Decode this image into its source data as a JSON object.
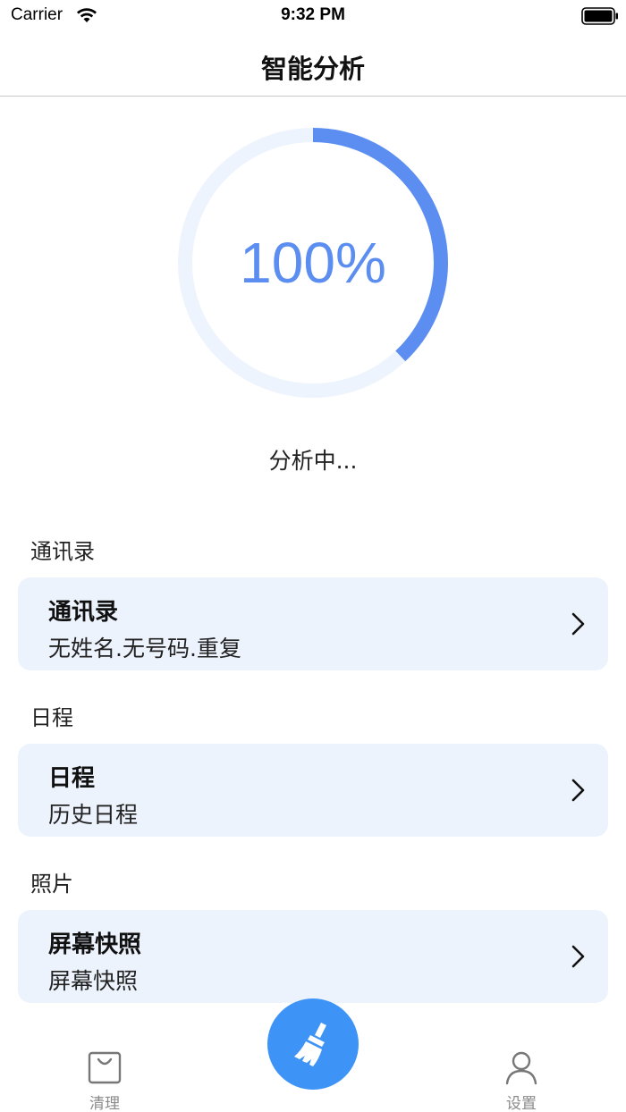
{
  "status_bar": {
    "carrier": "Carrier",
    "time": "9:32 PM",
    "wifi_icon": "wifi-icon",
    "battery_icon": "battery-icon"
  },
  "nav": {
    "title": "智能分析"
  },
  "progress": {
    "label": "100%",
    "fraction_drawn": 0.38,
    "status": "分析中...",
    "colors": {
      "arc": "#5b8ef0",
      "track": "#eef4fd",
      "text": "#5b8ef0"
    }
  },
  "sections": [
    {
      "title": "通讯录",
      "card_title": "通讯录",
      "card_subtitle": "无姓名.无号码.重复",
      "icon": "chevron-right-icon"
    },
    {
      "title": "日程",
      "card_title": "日程",
      "card_subtitle": "历史日程",
      "icon": "chevron-right-icon"
    },
    {
      "title": "照片",
      "card_title": "屏幕快照",
      "card_subtitle": "屏幕快照",
      "icon": "chevron-right-icon"
    }
  ],
  "tab_bar": {
    "left": {
      "label": "清理",
      "icon": "shopping-bag-icon"
    },
    "center": {
      "icon": "broom-icon",
      "color": "#3d93f6"
    },
    "right": {
      "label": "设置",
      "icon": "person-icon"
    }
  },
  "colors": {
    "card_background": "#edf3fd",
    "accent": "#3d93f6"
  }
}
